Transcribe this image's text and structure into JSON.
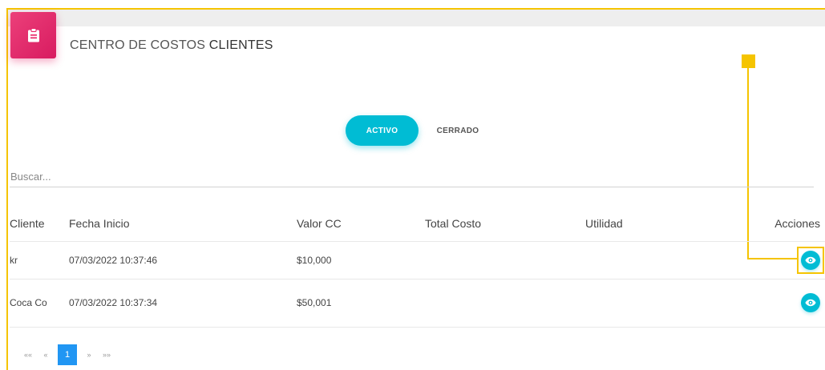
{
  "header": {
    "title_prefix": "CENTRO DE COSTOS ",
    "title_strong": "CLIENTES",
    "icon": "clipboard-icon",
    "icon_color": "#e91e63"
  },
  "tabs": [
    {
      "label": "ACTIVO",
      "active": true
    },
    {
      "label": "CERRADO",
      "active": false
    }
  ],
  "search": {
    "placeholder": "Buscar...",
    "value": ""
  },
  "table": {
    "columns": [
      "Cliente",
      "Fecha Inicio",
      "Valor CC",
      "Total Costo",
      "Utilidad",
      "Acciones"
    ],
    "rows": [
      {
        "cliente": "kr",
        "fecha_inicio": "07/03/2022 10:37:46",
        "valor_cc": "$10,000",
        "total_costo": "",
        "utilidad": "",
        "accion_icon": "eye-icon"
      },
      {
        "cliente": "Coca Co",
        "fecha_inicio": "07/03/2022 10:37:34",
        "valor_cc": "$50,001",
        "total_costo": "",
        "utilidad": "",
        "accion_icon": "eye-icon"
      }
    ]
  },
  "pagination": {
    "first": "««",
    "prev": "«",
    "current": "1",
    "next": "»",
    "last": "»»"
  },
  "colors": {
    "accent": "#00bcd4",
    "header_icon": "#e91e63",
    "page_active": "#2196f3",
    "highlight": "#f5c400"
  }
}
